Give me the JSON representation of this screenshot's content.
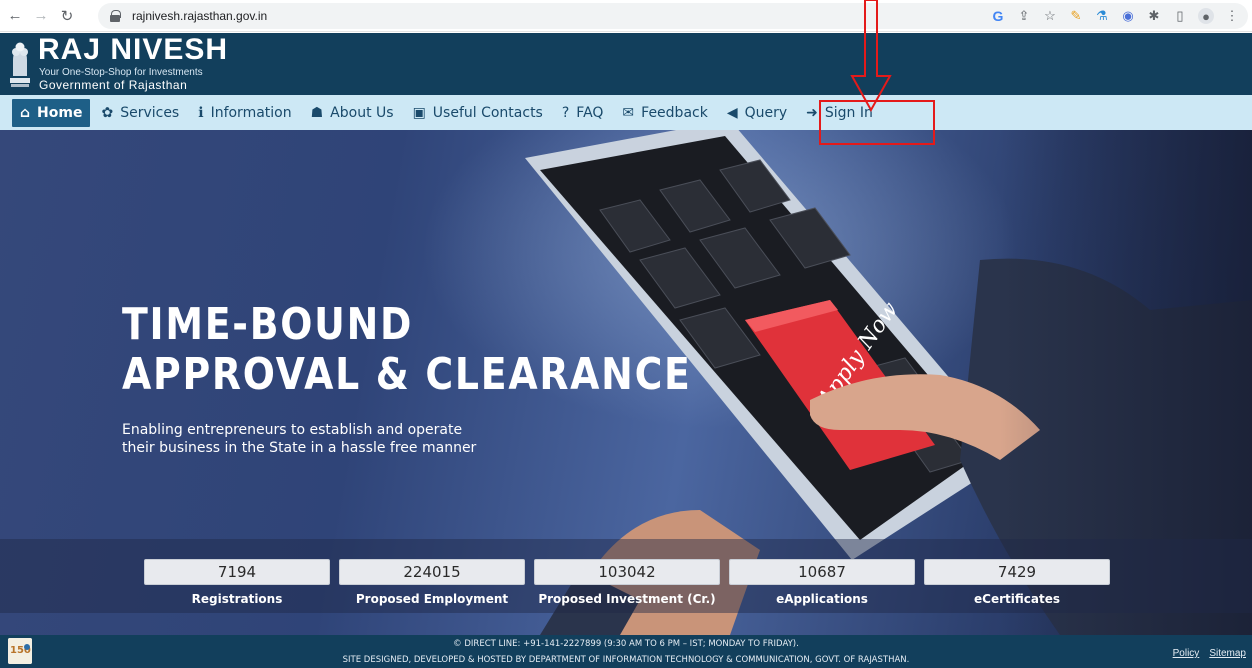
{
  "browser": {
    "url": "rajnivesh.rajasthan.gov.in",
    "icons": [
      "back-icon",
      "forward-icon",
      "reload-icon",
      "lock-icon",
      "google-icon",
      "share-icon",
      "star-icon",
      "pen-extension-icon",
      "flask-extension-icon",
      "record-extension-icon",
      "puzzle-extension-icon",
      "sidepanel-icon",
      "profile-icon",
      "menu-icon"
    ]
  },
  "header": {
    "title": "RAJ NIVESH",
    "tagline": "Your One-Stop-Shop for Investments",
    "government": "Government of Rajasthan"
  },
  "menu": {
    "items": [
      {
        "label": "Home",
        "icon": "home-icon",
        "glyph": "⌂",
        "active": true
      },
      {
        "label": "Services",
        "icon": "gear-icon",
        "glyph": "✿",
        "active": false
      },
      {
        "label": "Information",
        "icon": "info-icon",
        "glyph": "ℹ",
        "active": false
      },
      {
        "label": "About Us",
        "icon": "user-icon",
        "glyph": "☗",
        "active": false
      },
      {
        "label": "Useful Contacts",
        "icon": "contact-book-icon",
        "glyph": "▣",
        "active": false
      },
      {
        "label": "FAQ",
        "icon": "question-icon",
        "glyph": "?",
        "active": false
      },
      {
        "label": "Feedback",
        "icon": "comments-icon",
        "glyph": "✉",
        "active": false
      },
      {
        "label": "Query",
        "icon": "megaphone-icon",
        "glyph": "◀",
        "active": false
      },
      {
        "label": "Sign In",
        "icon": "sign-in-icon",
        "glyph": "➜",
        "active": false
      }
    ]
  },
  "hero": {
    "title_line1": "TIME-BOUND",
    "title_line2": "APPROVAL & CLEARANCE",
    "subtitle_line1": "Enabling entrepreneurs to establish and operate",
    "subtitle_line2": "their business in the State in a hassle free manner",
    "key_label": "Apply Now"
  },
  "stats": [
    {
      "value": "7194",
      "label": "Registrations"
    },
    {
      "value": "224015",
      "label": "Proposed Employment"
    },
    {
      "value": "103042",
      "label": "Proposed Investment (Cr.)"
    },
    {
      "value": "10687",
      "label": "eApplications"
    },
    {
      "value": "7429",
      "label": "eCertificates"
    }
  ],
  "footer": {
    "line1": "© DIRECT LINE: +91-141-2227899 (9:30 AM TO 6 PM – IST; MONDAY TO FRIDAY).",
    "line2": "SITE DESIGNED, DEVELOPED & HOSTED BY DEPARTMENT OF INFORMATION TECHNOLOGY & COMMUNICATION, GOVT. OF RAJASTHAN.",
    "links": [
      "Policy",
      "Sitemap"
    ]
  },
  "colors": {
    "header_bg": "#123f5c",
    "menu_bg": "#cde8f5",
    "menu_active": "#1e5f87",
    "annotation": "#e41a1a"
  }
}
